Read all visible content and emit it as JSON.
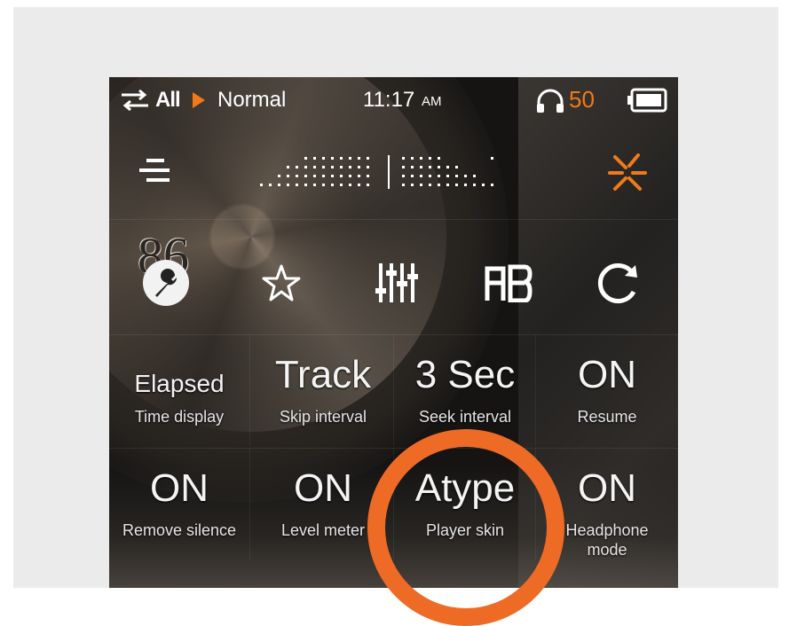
{
  "status": {
    "repeat_mode": "All",
    "play_state": "playing",
    "eq_preset": "Normal",
    "time": "11:17",
    "ampm": "AM",
    "volume": "50",
    "battery_level": 1.0
  },
  "colors": {
    "accent": "#f07a1a",
    "highlight_circle": "#ee6b26"
  },
  "shortcut_number": "86",
  "settings": [
    {
      "value": "Elapsed",
      "label": "Time display"
    },
    {
      "value": "Track",
      "label": "Skip interval"
    },
    {
      "value": "3 Sec",
      "label": "Seek interval"
    },
    {
      "value": "ON",
      "label": "Resume"
    },
    {
      "value": "ON",
      "label": "Remove silence"
    },
    {
      "value": "ON",
      "label": "Level meter"
    },
    {
      "value": "Atype",
      "label": "Player skin"
    },
    {
      "value": "ON",
      "label": "Headphone mode"
    }
  ],
  "icons": {
    "menu": "menu-icon",
    "level_meter": "level-meter-icon",
    "settings": "settings-icon",
    "tools": "wrench-icon",
    "favorite": "star-icon",
    "equalizer": "equalizer-icon",
    "ab_repeat": "ab-repeat-icon",
    "refresh": "refresh-icon"
  }
}
